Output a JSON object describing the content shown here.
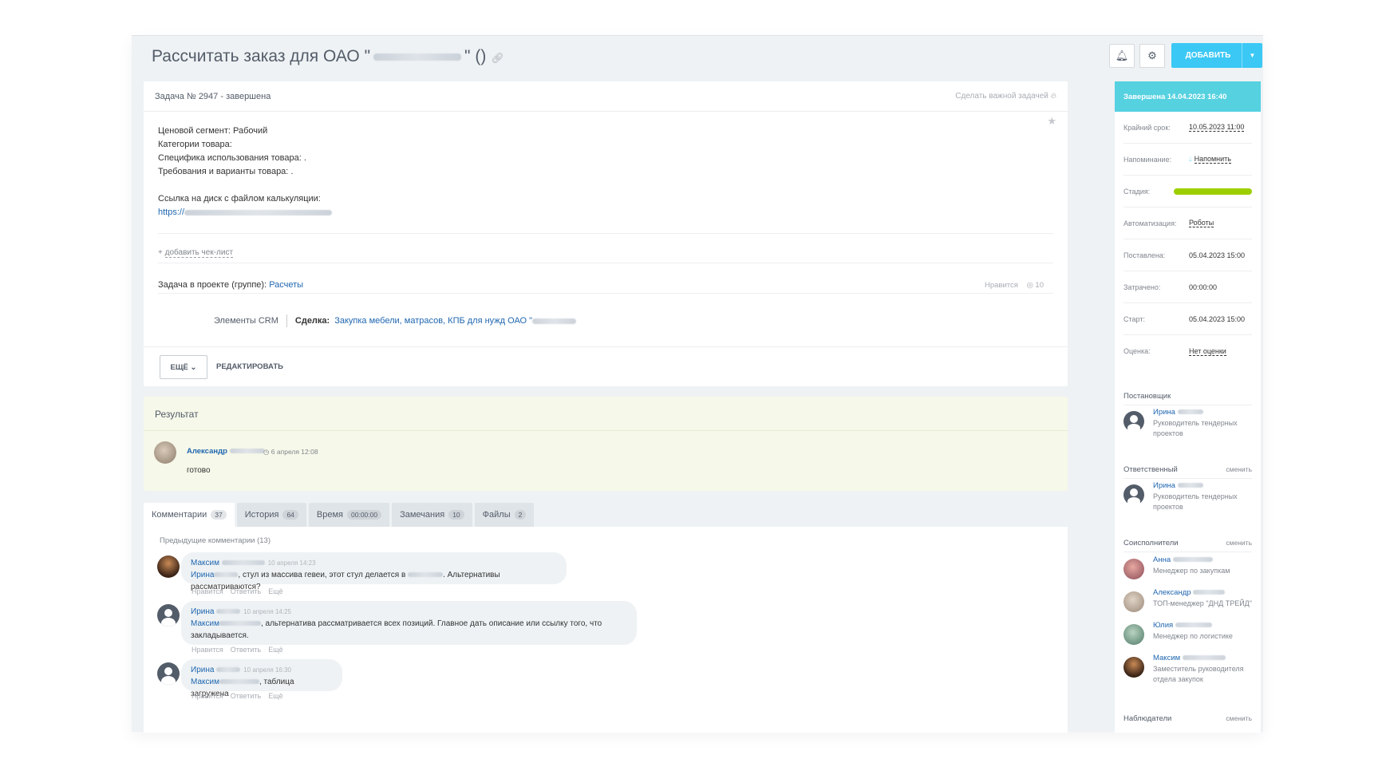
{
  "header": {
    "title": "Рассчитать заказ для ОАО \"",
    "title_suffix": "\" ()",
    "add_label": "ДОБАВИТЬ"
  },
  "task": {
    "heading": "Задача № 2947 - завершена",
    "make_important": "Сделать важной задачей",
    "description": [
      "Ценовой сегмент: Рабочий",
      "Категории товара:",
      "Специфика использования товара: .",
      "Требования и варианты товара: ."
    ],
    "link_label": "Ссылка на диск с файлом калькуляции:",
    "link_prefix": "https://",
    "add_checklist": "добавить чек-лист",
    "project_label": "Задача в проекте (группе):",
    "project_name": "Расчеты",
    "like_label": "Нравится",
    "views": "10",
    "crm_label": "Элементы CRM",
    "deal_label": "Сделка:",
    "deal_name": "Закупка мебели, матрасов, КПБ для нужд ОАО \"",
    "more_label": "ЕЩЁ",
    "edit_label": "РЕДАКТИРОВАТЬ"
  },
  "result": {
    "title": "Результат",
    "author": "Александр",
    "time": "6 апреля 12:08",
    "text": "готово"
  },
  "tabs": [
    {
      "label": "Комментарии",
      "count": "37"
    },
    {
      "label": "История",
      "count": "64"
    },
    {
      "label": "Время",
      "count": "00:00:00"
    },
    {
      "label": "Замечания",
      "count": "10"
    },
    {
      "label": "Файлы",
      "count": "2"
    }
  ],
  "comments": {
    "previous": "Предыдущие комментарии (13)",
    "items": [
      {
        "author": "Максим",
        "time": "10 апреля 14:23",
        "mention": "Ирина",
        "text_a": ", стул из массива гевеи, этот стул делается в ",
        "text_b": ". Альтернативы рассматриваются?"
      },
      {
        "author": "Ирина",
        "time": "10 апреля 14:25",
        "mention": "Максим",
        "text_a": ", альтернатива рассматривается всех позиций. Главное дать описание или ссылку того, что",
        "text_b": "закладывается."
      },
      {
        "author": "Ирина",
        "time": "10 апреля 16:30",
        "mention": "Максим",
        "text_a": ", таблица загружена",
        "text_b": ""
      }
    ],
    "actions": {
      "like": "Нравится",
      "reply": "Ответить",
      "more": "Ещё"
    }
  },
  "sidebar": {
    "status": "Завершена 14.04.2023 16:40",
    "rows": [
      {
        "key": "Крайний срок:",
        "value": "10.05.2023 11:00"
      },
      {
        "key": "Напоминание:",
        "value": "Напомнить"
      },
      {
        "key": "Стадия:",
        "value": ""
      },
      {
        "key": "Автоматизация:",
        "value": "Роботы"
      },
      {
        "key": "Поставлена:",
        "value": "05.04.2023 15:00"
      },
      {
        "key": "Затрачено:",
        "value": "00:00:00"
      },
      {
        "key": "Старт:",
        "value": "05.04.2023 15:00"
      },
      {
        "key": "Оценка:",
        "value": "Нет оценки"
      }
    ],
    "creator_label": "Постановщик",
    "responsible_label": "Ответственный",
    "coexec_label": "Соисполнители",
    "observers_label": "Наблюдатели",
    "change_label": "сменить",
    "creator": {
      "name": "Ирина",
      "position": "Руководитель тендерных проектов"
    },
    "responsible": {
      "name": "Ирина",
      "position": "Руководитель тендерных проектов"
    },
    "coexecutors": [
      {
        "name": "Анна",
        "position": "Менеджер по закупкам"
      },
      {
        "name": "Александр",
        "position": "ТОП-менеджер \"ДНД ТРЕЙД\""
      },
      {
        "name": "Юлия",
        "position": "Менеджер по логистике"
      },
      {
        "name": "Максим",
        "position": "Заместитель руководителя отдела закупок"
      }
    ]
  }
}
